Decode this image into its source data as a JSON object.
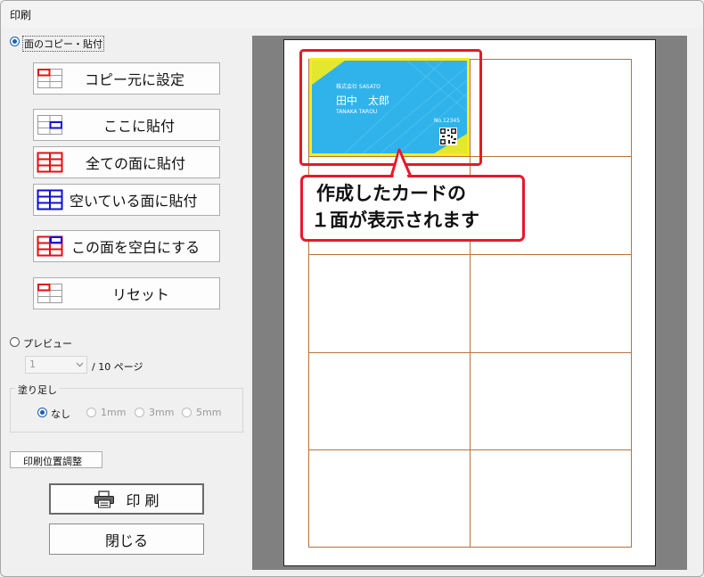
{
  "window": {
    "title": "印刷"
  },
  "mode_copy": {
    "label": "面のコピー・貼付"
  },
  "copy_buttons": {
    "set_source": "コピー元に設定",
    "paste_here": "ここに貼付",
    "paste_all": "全ての面に貼付",
    "paste_empty": "空いている面に貼付",
    "make_blank": "この面を空白にする",
    "reset": "リセット"
  },
  "mode_preview": {
    "label": "プレビュー"
  },
  "page_selector": {
    "value": "1",
    "total": "/ 10 ページ"
  },
  "bleed": {
    "group_label": "塗り足し",
    "options": [
      "なし",
      "1mm",
      "3mm",
      "5mm"
    ],
    "selected": "なし"
  },
  "position_adjust_label": "印刷位置調整",
  "print_label": "印 刷",
  "close_label": "閉じる",
  "card": {
    "company": "株式会社 SASATO",
    "name": "田中　太郎",
    "romaji": "TANAKA TAROU",
    "number": "No.12345",
    "bg_color": "#2fb3ea",
    "frame_color": "#f7ec1a"
  },
  "callout": {
    "line1": "作成したカードの",
    "line2": "１面が表示されます",
    "color": "#e8182a"
  },
  "sheet": {
    "rows": 5,
    "cols": 2
  }
}
